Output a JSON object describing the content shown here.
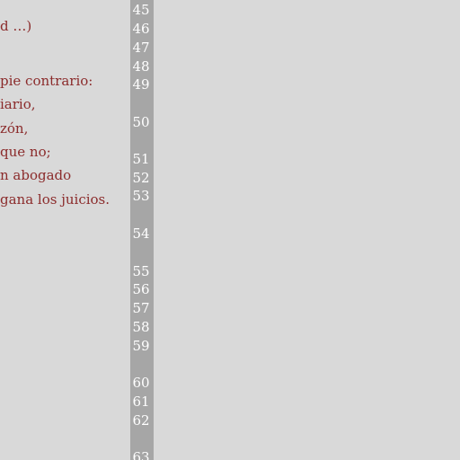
{
  "editor": {
    "text_lines": [
      "d …)",
      "",
      "pie contrario:",
      "iario,",
      "zón,",
      "que no;",
      "n abogado",
      "gana los juicios."
    ],
    "line_numbers": [
      "45",
      "46",
      "47",
      "48",
      "49",
      "50",
      "51",
      "52",
      "53",
      "54",
      "55",
      "56",
      "57",
      "58",
      "59",
      "60",
      "61",
      "62",
      "63"
    ]
  },
  "colors": {
    "background": "#d9d9d9",
    "gutter": "#a6a6a6",
    "text": "#8b2b2b",
    "line_number": "#ffffff"
  }
}
